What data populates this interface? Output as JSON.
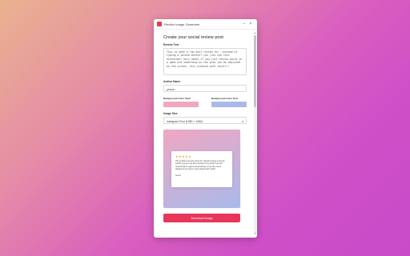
{
  "window": {
    "title": "Review Image Generator",
    "minimize_glyph": "–",
    "close_glyph": "×"
  },
  "heading": "Create your social review post",
  "review": {
    "label": "Review Text",
    "value": "This is what a raw-text review for, instead of typing a second marble? you just use this extension! Very handy if you just review build in a game did something on the plan can be adjusted on the screen. Very pleased with result!!"
  },
  "author": {
    "label": "Author Name",
    "value": "person"
  },
  "colors": {
    "start_label": "Background Color Start",
    "end_label": "Background Color End",
    "start": "#f0a7c2",
    "end": "#a9b9ea"
  },
  "size": {
    "label": "Image Size",
    "value": "Instagram Post (1080 × 1080)"
  },
  "preview": {
    "stars": "★★★★★",
    "text": "This is what a raw-text review for, instead of typing a second marble? you just use this extension! Very handy if you just review build in a game did something on the plan can be adjusted on the screen. Very pleased with result!!",
    "author": "person"
  },
  "download_label": "Download Image",
  "scroll": {
    "up_glyph": "▲",
    "down_glyph": "▼"
  }
}
